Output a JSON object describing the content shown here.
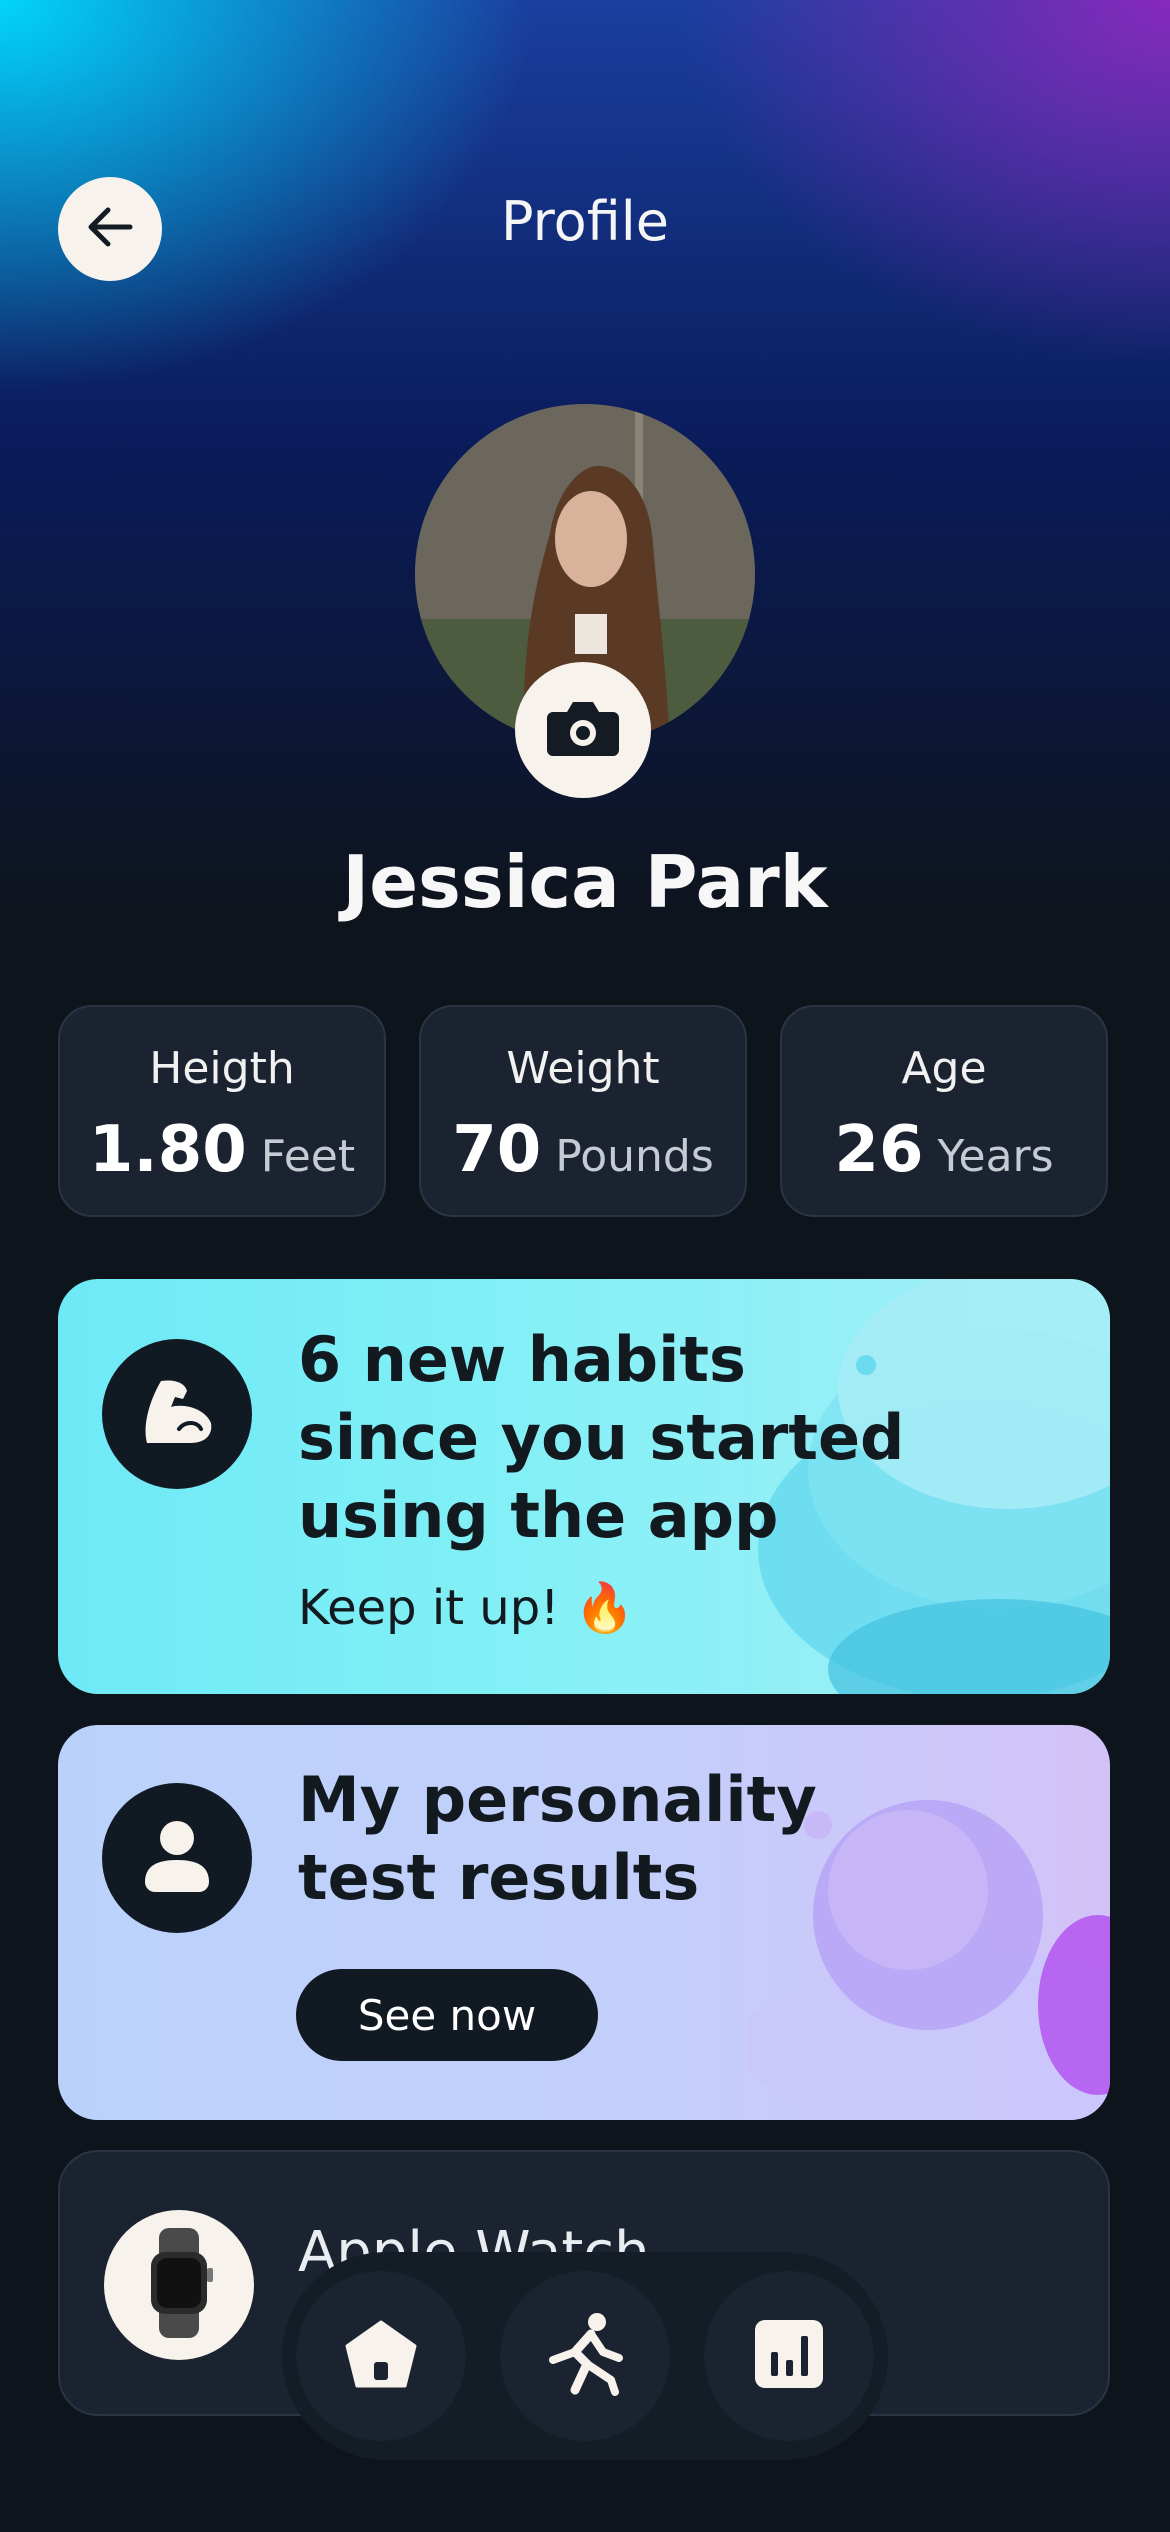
{
  "header": {
    "title": "Profile",
    "back_icon": "arrow-left-icon"
  },
  "profile": {
    "name": "Jessica Park",
    "avatar": "profile-photo",
    "camera_icon": "camera-icon"
  },
  "stats": [
    {
      "label": "Heigth",
      "value": "1.80",
      "unit": "Feet"
    },
    {
      "label": "Weight",
      "value": "70",
      "unit": "Pounds"
    },
    {
      "label": "Age",
      "value": "26",
      "unit": "Years"
    }
  ],
  "cards": {
    "habits": {
      "title": "6 new habits since you started using the app",
      "subtitle": "Keep it up! 🔥",
      "icon": "flexed-bicep-icon",
      "color": "#6ee9f6"
    },
    "personality": {
      "title": "My personality test results",
      "button_label": "See now",
      "icon": "user-icon",
      "color": "#bad2fb"
    },
    "device": {
      "title": "Apple Watch",
      "icon": "watch-icon"
    }
  },
  "nav": {
    "items": [
      {
        "icon": "home-icon"
      },
      {
        "icon": "running-icon"
      },
      {
        "icon": "bar-chart-icon"
      }
    ]
  },
  "colors": {
    "background": "#0e141b",
    "surface": "#1b2330",
    "light": "#f7f3ec"
  }
}
